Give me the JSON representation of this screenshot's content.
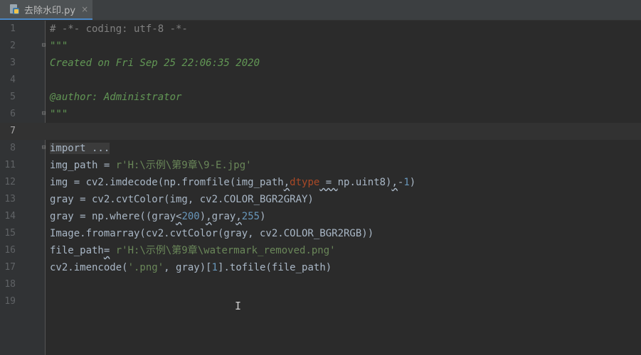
{
  "tab": {
    "title": "去除水印.py",
    "close": "×",
    "icon": "python-file-icon"
  },
  "lines": [
    {
      "num": "1",
      "parts": [
        {
          "t": "# -*- coding: utf-8 -*-",
          "c": "comment"
        }
      ]
    },
    {
      "num": "2",
      "parts": [
        {
          "t": "\"\"\"",
          "c": "doc"
        }
      ]
    },
    {
      "num": "3",
      "parts": [
        {
          "t": "Created on Fri Sep 25 22:06:35 2020",
          "c": "doc"
        }
      ]
    },
    {
      "num": "4",
      "parts": []
    },
    {
      "num": "5",
      "parts": [
        {
          "t": "@author: Administrator",
          "c": "doc"
        }
      ]
    },
    {
      "num": "6",
      "parts": [
        {
          "t": "\"\"\"",
          "c": "doc"
        }
      ]
    },
    {
      "num": "7",
      "parts": []
    },
    {
      "num": "8",
      "parts": [
        {
          "t": "import ...",
          "c": "import-fold"
        }
      ]
    },
    {
      "num": "11",
      "parts": [
        {
          "t": "img_path = ",
          "c": ""
        },
        {
          "t": "r'H:\\示例\\第9章\\9-E.jpg'",
          "c": "str"
        }
      ]
    },
    {
      "num": "12",
      "parts": [
        {
          "t": "img = cv2.imdecode(np.fromfile(img_path",
          "c": ""
        },
        {
          "t": ",",
          "c": "squiggle"
        },
        {
          "t": "dtype",
          "c": "param"
        },
        {
          "t": " = ",
          "c": "squiggle"
        },
        {
          "t": "np.uint8)",
          "c": ""
        },
        {
          "t": ",",
          "c": "squiggle"
        },
        {
          "t": "-",
          "c": ""
        },
        {
          "t": "1",
          "c": "num"
        },
        {
          "t": ")",
          "c": ""
        }
      ]
    },
    {
      "num": "13",
      "parts": [
        {
          "t": "gray = cv2.cvtColor(img, cv2.COLOR_BGR2GRAY)",
          "c": ""
        }
      ]
    },
    {
      "num": "14",
      "parts": [
        {
          "t": "gray = np.where((gray",
          "c": ""
        },
        {
          "t": "<",
          "c": "squiggle"
        },
        {
          "t": "200",
          "c": "num"
        },
        {
          "t": ")",
          "c": ""
        },
        {
          "t": ",",
          "c": "squiggle"
        },
        {
          "t": "gray",
          "c": ""
        },
        {
          "t": ",",
          "c": "squiggle"
        },
        {
          "t": "255",
          "c": "num"
        },
        {
          "t": ")",
          "c": ""
        }
      ]
    },
    {
      "num": "15",
      "parts": [
        {
          "t": "Image.fromarray(cv2.cvtColor(gray, cv2.COLOR_BGR2RGB))",
          "c": ""
        }
      ]
    },
    {
      "num": "16",
      "parts": [
        {
          "t": "file_path",
          "c": ""
        },
        {
          "t": "=",
          "c": "squiggle"
        },
        {
          "t": " ",
          "c": ""
        },
        {
          "t": "r'H:\\示例\\第9章\\watermark_removed.png'",
          "c": "str"
        }
      ]
    },
    {
      "num": "17",
      "parts": [
        {
          "t": "cv2.imencode(",
          "c": ""
        },
        {
          "t": "'.png'",
          "c": "str"
        },
        {
          "t": ", gray)[",
          "c": ""
        },
        {
          "t": "1",
          "c": "num"
        },
        {
          "t": "].tofile(file_path)",
          "c": ""
        }
      ]
    },
    {
      "num": "18",
      "parts": []
    },
    {
      "num": "19",
      "parts": []
    }
  ],
  "fold_lines": [
    "2",
    "6",
    "8"
  ],
  "current_line": "7",
  "text_cursor": "I",
  "colors": {
    "background": "#2b2b2b",
    "gutter": "#313335",
    "comment": "#808080",
    "docstring": "#629755",
    "string": "#6a8759",
    "number": "#6897bb",
    "param": "#aa4926",
    "default": "#a9b7c6"
  }
}
